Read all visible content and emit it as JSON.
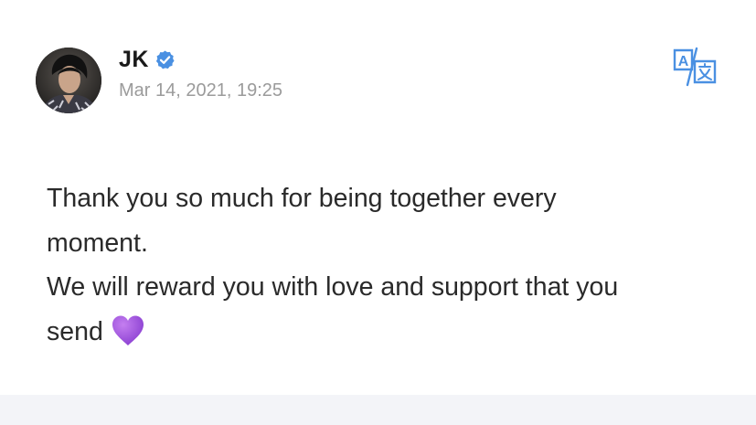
{
  "post": {
    "author": {
      "name": "JK",
      "verified": true,
      "avatar_icon": "avatar-photo"
    },
    "timestamp": "Mar 14, 2021, 19:25",
    "body_lines": [
      "Thank you so much for being together every",
      "moment.",
      "We will reward you with love and support that you",
      "send"
    ],
    "emoji": "purple-heart-icon",
    "translate_icon": "translate-icon"
  },
  "colors": {
    "verified_blue": "#4a90e2",
    "translate_blue": "#4a90e2",
    "heart_purple": "#9b4fd6",
    "timestamp_gray": "#9b9b9b",
    "bottom_bar": "#f3f4f8"
  }
}
